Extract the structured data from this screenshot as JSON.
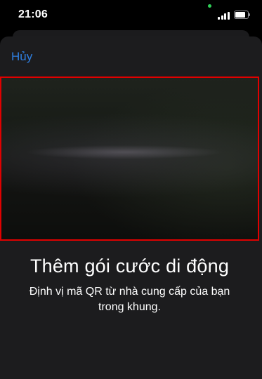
{
  "status_bar": {
    "time": "21:06",
    "icons": [
      "signal-bars-icon",
      "battery-icon"
    ],
    "indicator_color": "#30d158"
  },
  "nav": {
    "cancel_label": "Hủy"
  },
  "scanner": {
    "frame_color": "#e00000"
  },
  "content": {
    "title": "Thêm gói cước di động",
    "subtitle": "Định vị mã QR từ nhà cung cấp của bạn trong khung."
  },
  "colors": {
    "accent": "#2f7fe0",
    "sheet_background": "#1c1c1e",
    "screen_background": "#000000"
  }
}
